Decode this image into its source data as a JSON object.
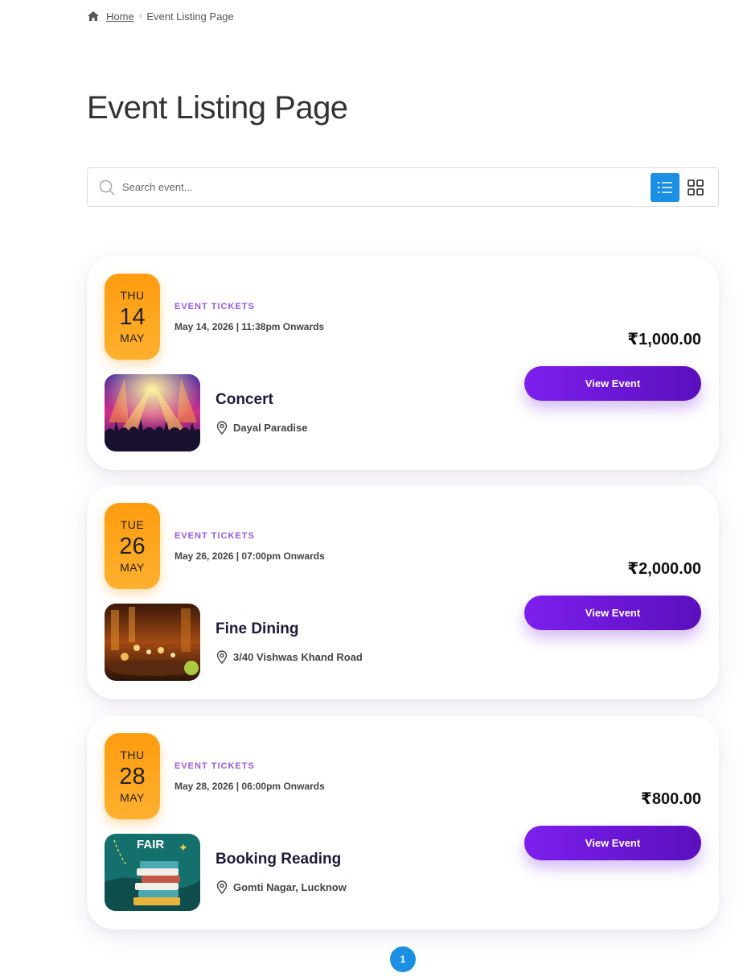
{
  "breadcrumb": {
    "home_label": "Home",
    "current": "Event Listing Page"
  },
  "page": {
    "title": "Event Listing Page"
  },
  "search": {
    "placeholder": "Search event...",
    "value": ""
  },
  "view_modes": {
    "active": "list",
    "options": [
      "list",
      "grid"
    ]
  },
  "events": [
    {
      "dow": "THU",
      "day": "14",
      "month": "MAY",
      "category": "EVENT TICKETS",
      "datetime": "May 14, 2026 | 11:38pm Onwards",
      "name": "Concert",
      "location": "Dayal Paradise",
      "price": "₹1,000.00",
      "button_label": "View Event",
      "thumb_kind": "concert"
    },
    {
      "dow": "TUE",
      "day": "26",
      "month": "MAY",
      "category": "EVENT TICKETS",
      "datetime": "May 26, 2026 | 07:00pm Onwards",
      "name": "Fine Dining",
      "location": "3/40 Vishwas Khand Road",
      "price": "₹2,000.00",
      "button_label": "View Event",
      "thumb_kind": "dining"
    },
    {
      "dow": "THU",
      "day": "28",
      "month": "MAY",
      "category": "EVENT TICKETS",
      "datetime": "May 28, 2026 | 06:00pm Onwards",
      "name": "Booking Reading",
      "location": "Gomti Nagar, Lucknow",
      "price": "₹800.00",
      "button_label": "View Event",
      "thumb_kind": "books",
      "thumb_text": "FAIR"
    }
  ],
  "pagination": {
    "current_page": "1"
  },
  "colors": {
    "accent_blue": "#1a8fe3",
    "badge_orange": "#ff9c0f",
    "button_purple": "#7d1fee",
    "category_purple": "#9a57ea"
  }
}
